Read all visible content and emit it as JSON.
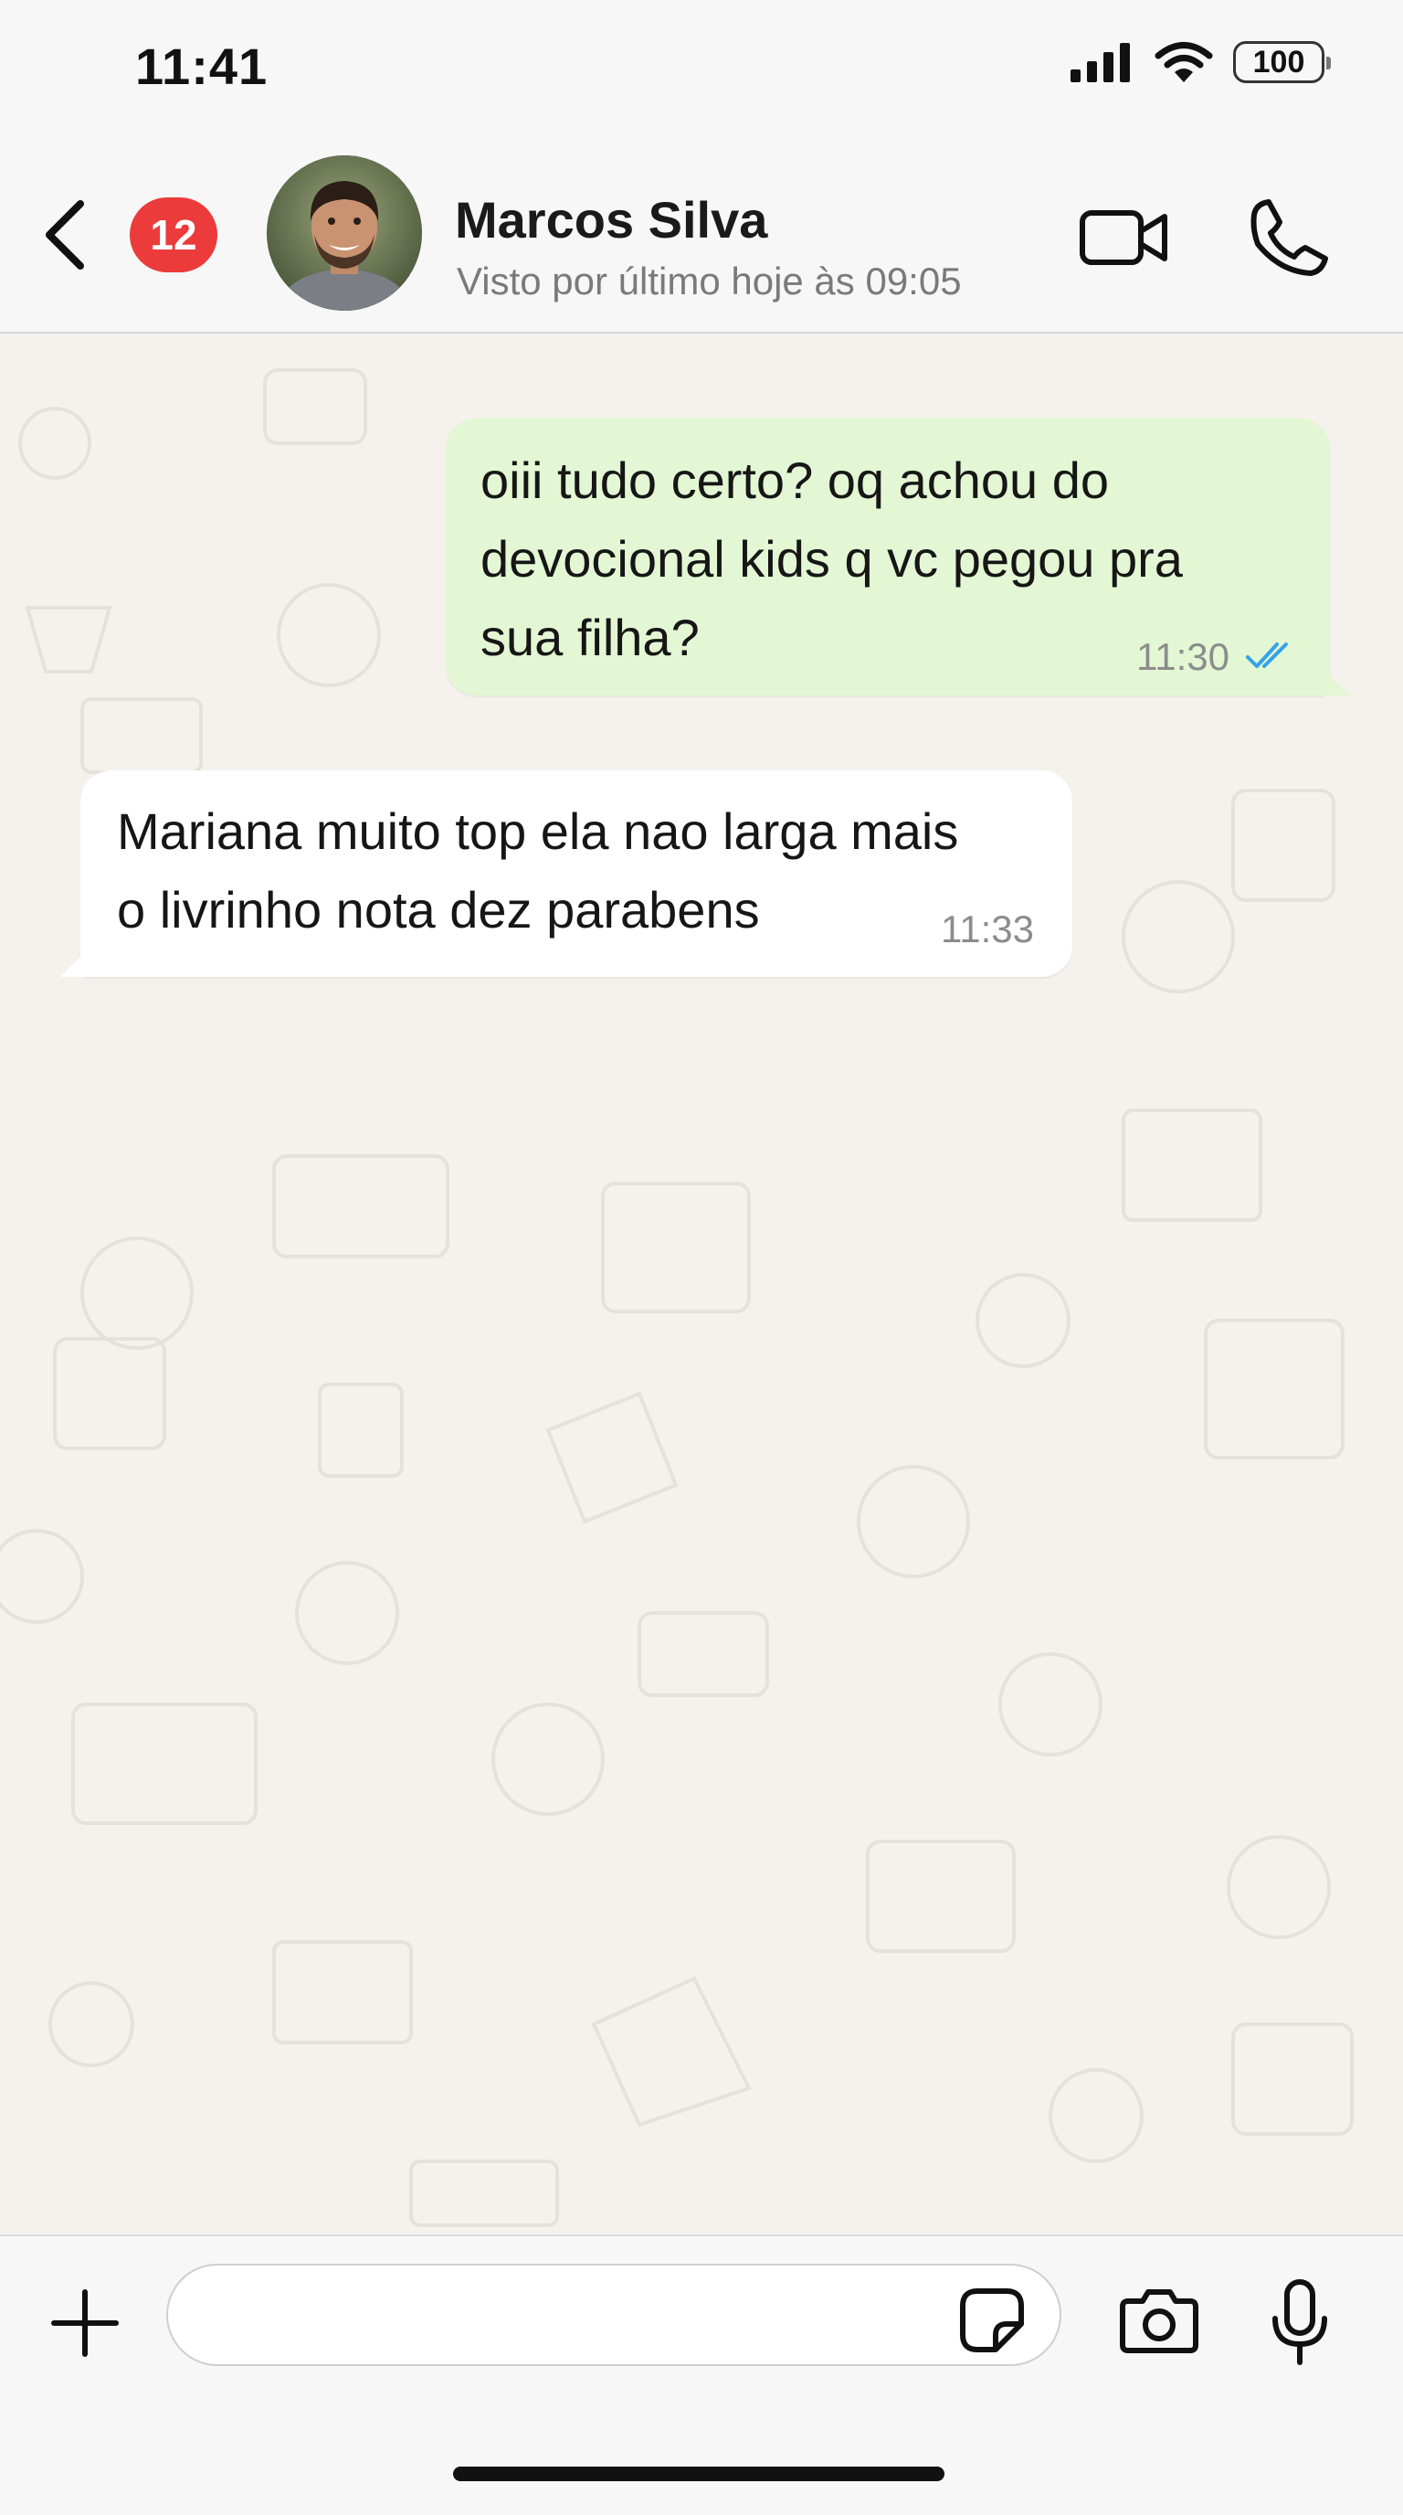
{
  "status_bar": {
    "time": "11:41",
    "battery": "100",
    "icons": [
      "signal-icon",
      "wifi-icon",
      "battery-icon"
    ]
  },
  "header": {
    "unread_count": "12",
    "contact_name": "Marcos Silva",
    "last_seen": "Visto por último hoje às 09:05",
    "icons": [
      "back-icon",
      "video-call-icon",
      "phone-icon"
    ]
  },
  "messages": [
    {
      "direction": "outgoing",
      "lines": [
        "oiii tudo certo? oq achou do",
        "devocional kids q vc pegou pra",
        "sua filha?"
      ],
      "time": "11:30",
      "status": "read",
      "status_color": "#34a3e8"
    },
    {
      "direction": "incoming",
      "lines": [
        "Mariana muito top ela nao larga mais",
        "o livrinho nota dez parabens"
      ],
      "time": "11:33"
    }
  ],
  "input": {
    "value": "",
    "placeholder": "",
    "icons": [
      "plus-icon",
      "sticker-icon",
      "camera-icon",
      "microphone-icon"
    ]
  },
  "colors": {
    "badge": "#eb3b3b",
    "outgoing_bubble": "#e3f7d4",
    "incoming_bubble": "#ffffff",
    "chat_background": "#f5f2ee"
  }
}
